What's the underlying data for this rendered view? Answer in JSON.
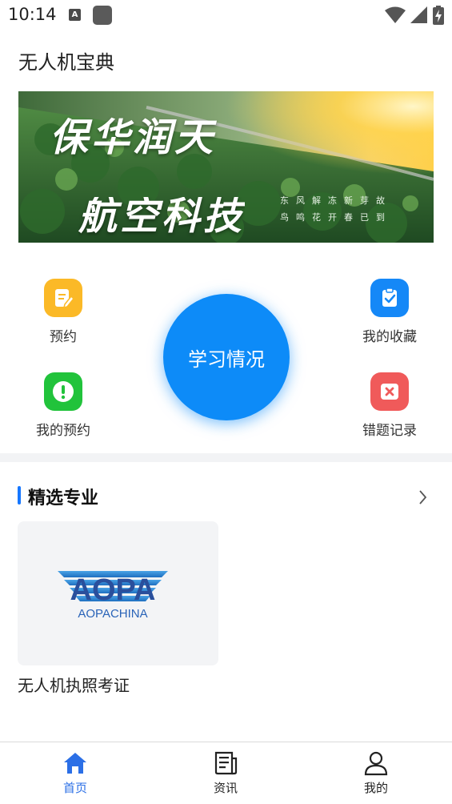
{
  "status_bar": {
    "time": "10:14",
    "left_icons": [
      "a-notification-icon",
      "app-square-icon"
    ],
    "right_icons": [
      "wifi-icon",
      "signal-icon",
      "battery-charging-icon"
    ]
  },
  "header": {
    "title": "无人机宝典"
  },
  "banner": {
    "headline_line1": "保华润天",
    "headline_line2": "航空科技",
    "poem_line1": "东风解冻新芽故",
    "poem_line2": "鸟鸣花开春已到"
  },
  "quick_actions": {
    "reserve": {
      "label": "预约",
      "icon": "note-edit-icon",
      "color": "#fbb927"
    },
    "favorites": {
      "label": "我的收藏",
      "icon": "clipboard-check-icon",
      "color": "#1588f7"
    },
    "my_reservations": {
      "label": "我的预约",
      "icon": "alert-icon",
      "color": "#21c33b"
    },
    "wrong_records": {
      "label": "错题记录",
      "icon": "close-card-icon",
      "color": "#f05a5a"
    },
    "study_status": {
      "label": "学习情况",
      "color": "#0d8bf8"
    }
  },
  "section": {
    "title": "精选专业",
    "accent_color": "#1677ff"
  },
  "courses": [
    {
      "title": "无人机执照考证",
      "logo_main": "AOPA",
      "logo_sub": "AOPACHINA"
    }
  ],
  "bottom_nav": {
    "items": [
      {
        "label": "首页",
        "icon": "home-icon",
        "active": true
      },
      {
        "label": "资讯",
        "icon": "news-icon",
        "active": false
      },
      {
        "label": "我的",
        "icon": "user-icon",
        "active": false
      }
    ],
    "active_color": "#2b6fe6"
  }
}
